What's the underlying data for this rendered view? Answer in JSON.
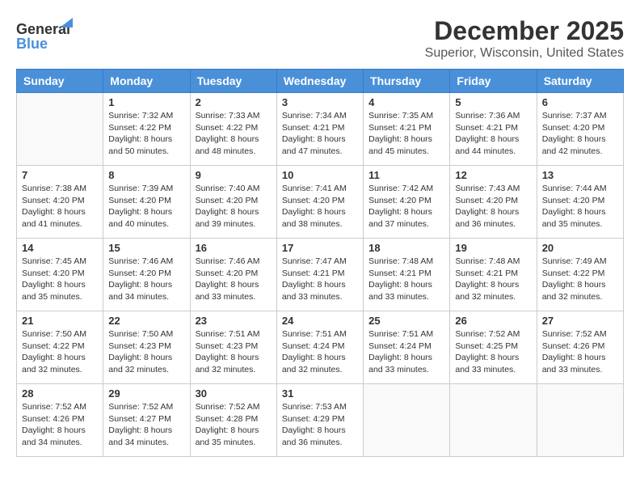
{
  "header": {
    "logo_general": "General",
    "logo_blue": "Blue",
    "title": "December 2025",
    "location": "Superior, Wisconsin, United States"
  },
  "calendar": {
    "days_of_week": [
      "Sunday",
      "Monday",
      "Tuesday",
      "Wednesday",
      "Thursday",
      "Friday",
      "Saturday"
    ],
    "weeks": [
      [
        {
          "day": "",
          "info": ""
        },
        {
          "day": "1",
          "info": "Sunrise: 7:32 AM\nSunset: 4:22 PM\nDaylight: 8 hours\nand 50 minutes."
        },
        {
          "day": "2",
          "info": "Sunrise: 7:33 AM\nSunset: 4:22 PM\nDaylight: 8 hours\nand 48 minutes."
        },
        {
          "day": "3",
          "info": "Sunrise: 7:34 AM\nSunset: 4:21 PM\nDaylight: 8 hours\nand 47 minutes."
        },
        {
          "day": "4",
          "info": "Sunrise: 7:35 AM\nSunset: 4:21 PM\nDaylight: 8 hours\nand 45 minutes."
        },
        {
          "day": "5",
          "info": "Sunrise: 7:36 AM\nSunset: 4:21 PM\nDaylight: 8 hours\nand 44 minutes."
        },
        {
          "day": "6",
          "info": "Sunrise: 7:37 AM\nSunset: 4:20 PM\nDaylight: 8 hours\nand 42 minutes."
        }
      ],
      [
        {
          "day": "7",
          "info": "Sunrise: 7:38 AM\nSunset: 4:20 PM\nDaylight: 8 hours\nand 41 minutes."
        },
        {
          "day": "8",
          "info": "Sunrise: 7:39 AM\nSunset: 4:20 PM\nDaylight: 8 hours\nand 40 minutes."
        },
        {
          "day": "9",
          "info": "Sunrise: 7:40 AM\nSunset: 4:20 PM\nDaylight: 8 hours\nand 39 minutes."
        },
        {
          "day": "10",
          "info": "Sunrise: 7:41 AM\nSunset: 4:20 PM\nDaylight: 8 hours\nand 38 minutes."
        },
        {
          "day": "11",
          "info": "Sunrise: 7:42 AM\nSunset: 4:20 PM\nDaylight: 8 hours\nand 37 minutes."
        },
        {
          "day": "12",
          "info": "Sunrise: 7:43 AM\nSunset: 4:20 PM\nDaylight: 8 hours\nand 36 minutes."
        },
        {
          "day": "13",
          "info": "Sunrise: 7:44 AM\nSunset: 4:20 PM\nDaylight: 8 hours\nand 35 minutes."
        }
      ],
      [
        {
          "day": "14",
          "info": "Sunrise: 7:45 AM\nSunset: 4:20 PM\nDaylight: 8 hours\nand 35 minutes."
        },
        {
          "day": "15",
          "info": "Sunrise: 7:46 AM\nSunset: 4:20 PM\nDaylight: 8 hours\nand 34 minutes."
        },
        {
          "day": "16",
          "info": "Sunrise: 7:46 AM\nSunset: 4:20 PM\nDaylight: 8 hours\nand 33 minutes."
        },
        {
          "day": "17",
          "info": "Sunrise: 7:47 AM\nSunset: 4:21 PM\nDaylight: 8 hours\nand 33 minutes."
        },
        {
          "day": "18",
          "info": "Sunrise: 7:48 AM\nSunset: 4:21 PM\nDaylight: 8 hours\nand 33 minutes."
        },
        {
          "day": "19",
          "info": "Sunrise: 7:48 AM\nSunset: 4:21 PM\nDaylight: 8 hours\nand 32 minutes."
        },
        {
          "day": "20",
          "info": "Sunrise: 7:49 AM\nSunset: 4:22 PM\nDaylight: 8 hours\nand 32 minutes."
        }
      ],
      [
        {
          "day": "21",
          "info": "Sunrise: 7:50 AM\nSunset: 4:22 PM\nDaylight: 8 hours\nand 32 minutes."
        },
        {
          "day": "22",
          "info": "Sunrise: 7:50 AM\nSunset: 4:23 PM\nDaylight: 8 hours\nand 32 minutes."
        },
        {
          "day": "23",
          "info": "Sunrise: 7:51 AM\nSunset: 4:23 PM\nDaylight: 8 hours\nand 32 minutes."
        },
        {
          "day": "24",
          "info": "Sunrise: 7:51 AM\nSunset: 4:24 PM\nDaylight: 8 hours\nand 32 minutes."
        },
        {
          "day": "25",
          "info": "Sunrise: 7:51 AM\nSunset: 4:24 PM\nDaylight: 8 hours\nand 33 minutes."
        },
        {
          "day": "26",
          "info": "Sunrise: 7:52 AM\nSunset: 4:25 PM\nDaylight: 8 hours\nand 33 minutes."
        },
        {
          "day": "27",
          "info": "Sunrise: 7:52 AM\nSunset: 4:26 PM\nDaylight: 8 hours\nand 33 minutes."
        }
      ],
      [
        {
          "day": "28",
          "info": "Sunrise: 7:52 AM\nSunset: 4:26 PM\nDaylight: 8 hours\nand 34 minutes."
        },
        {
          "day": "29",
          "info": "Sunrise: 7:52 AM\nSunset: 4:27 PM\nDaylight: 8 hours\nand 34 minutes."
        },
        {
          "day": "30",
          "info": "Sunrise: 7:52 AM\nSunset: 4:28 PM\nDaylight: 8 hours\nand 35 minutes."
        },
        {
          "day": "31",
          "info": "Sunrise: 7:53 AM\nSunset: 4:29 PM\nDaylight: 8 hours\nand 36 minutes."
        },
        {
          "day": "",
          "info": ""
        },
        {
          "day": "",
          "info": ""
        },
        {
          "day": "",
          "info": ""
        }
      ]
    ]
  }
}
